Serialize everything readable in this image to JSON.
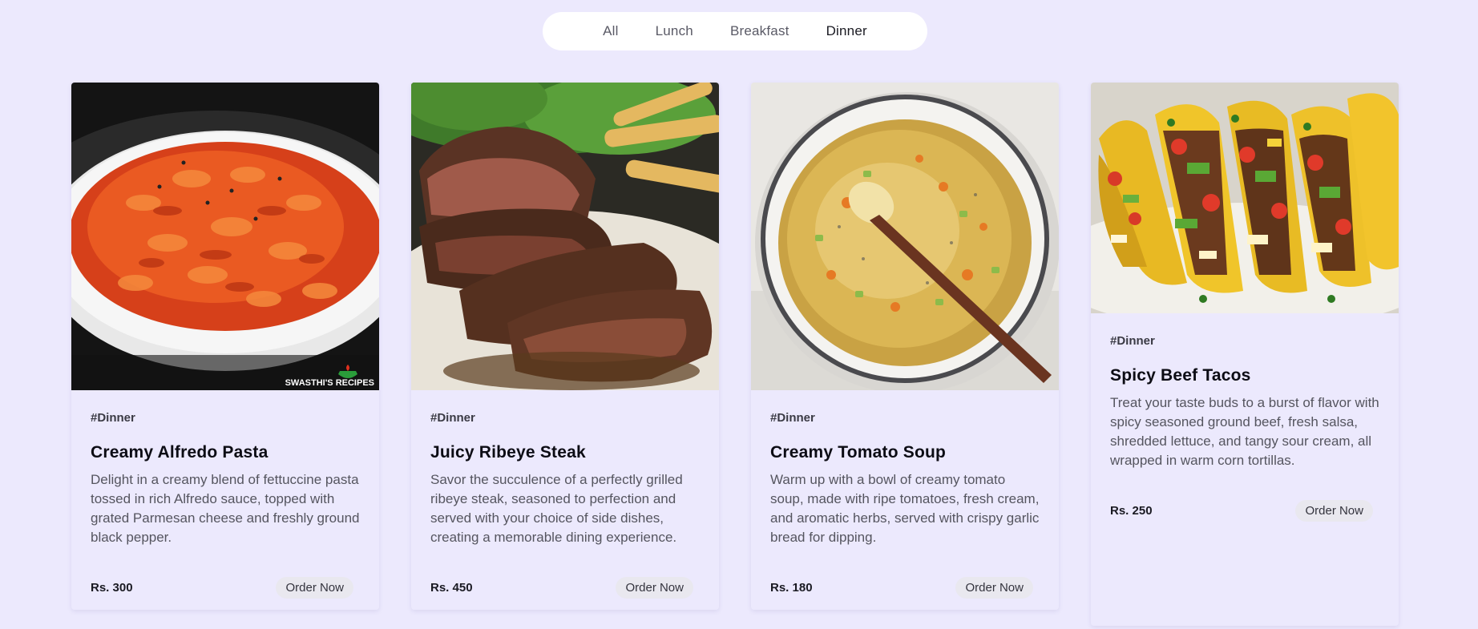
{
  "filters": {
    "all": "All",
    "lunch": "Lunch",
    "breakfast": "Breakfast",
    "dinner": "Dinner",
    "active": "Dinner"
  },
  "watermark": "SWASTHI'S RECIPES",
  "cards": [
    {
      "tag": "#Dinner",
      "title": "Creamy Alfredo Pasta",
      "description": "Delight in a creamy blend of fettuccine pasta tossed in rich Alfredo sauce, topped with grated Parmesan cheese and freshly ground black pepper.",
      "price": "Rs. 300",
      "button": "Order Now"
    },
    {
      "tag": "#Dinner",
      "title": "Juicy Ribeye Steak",
      "description": "Savor the succulence of a perfectly grilled ribeye steak, seasoned to perfection and served with your choice of side dishes, creating a memorable dining experience.",
      "price": "Rs. 450",
      "button": "Order Now"
    },
    {
      "tag": "#Dinner",
      "title": "Creamy Tomato Soup",
      "description": "Warm up with a bowl of creamy tomato soup, made with ripe tomatoes, fresh cream, and aromatic herbs, served with crispy garlic bread for dipping.",
      "price": "Rs. 180",
      "button": "Order Now"
    },
    {
      "tag": "#Dinner",
      "title": "Spicy Beef Tacos",
      "description": "Treat your taste buds to a burst of flavor with spicy seasoned ground beef, fresh salsa, shredded lettuce, and tangy sour cream, all wrapped in warm corn tortillas.",
      "price": "Rs. 250",
      "button": "Order Now"
    }
  ],
  "colors": {
    "background": "#ece9fd",
    "filter_bar": "#ffffff",
    "button_bg": "#e9e8ef"
  }
}
